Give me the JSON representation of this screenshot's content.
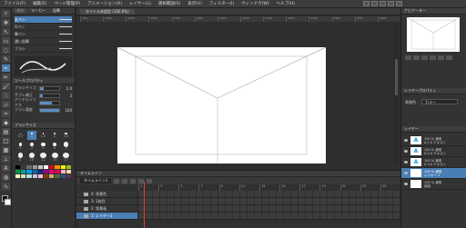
{
  "menu": [
    "ファイル(F)",
    "編集(E)",
    "ページ管理(P)",
    "アニメーション(A)",
    "レイヤー(L)",
    "選択範囲(S)",
    "表示(V)",
    "フィルター(I)",
    "ウィンドウ(W)",
    "ヘルプ(H)"
  ],
  "sub_tool": {
    "tabs": [
      "ペン",
      "マーカー",
      "鉛筆"
    ],
    "brushes": [
      {
        "label": "丸ペン"
      },
      {
        "label": "Gペン"
      },
      {
        "label": "筆ペン"
      },
      {
        "label": "濃い鉛筆"
      },
      {
        "label": "ブラシ"
      }
    ]
  },
  "tool_property": {
    "title": "ツールプロパティ",
    "rows": [
      {
        "label": "ブラシサイズ",
        "value": "1.0",
        "fill": 0.2
      },
      {
        "label": "手ブレ補正",
        "value": "3",
        "fill": 0.15
      },
      {
        "label": "アンチエイリアス",
        "value": "",
        "fill": 0.6
      },
      {
        "label": "ブラシ濃度",
        "value": "100",
        "fill": 1.0
      }
    ]
  },
  "brush_size": {
    "title": "ブラシサイズ",
    "sizes": [
      "0.7",
      "1",
      "1.5",
      "2",
      "2.5",
      "3",
      "4",
      "5",
      "6",
      "7",
      "8",
      "10",
      "12",
      "15",
      "17"
    ]
  },
  "palette_colors": [
    "#000000",
    "#3a3a3a",
    "#6e6e6e",
    "#9b9b9b",
    "#c8c8c8",
    "#ffffff",
    "#e60012",
    "#f39800",
    "#fff100",
    "#8fc31f",
    "#009944",
    "#009e96",
    "#00a0e9",
    "#0068b7",
    "#1d2088",
    "#920783",
    "#e4007f",
    "#e5004f",
    "#f4b4c3",
    "#ffd8a8",
    "#fffad0",
    "#c9e6b4",
    "#b4dde8",
    "#c7c3e6",
    "#f9c0d8",
    "#7f3f00",
    "#d4a373",
    "#4d6b3a",
    "#2c4f80",
    "#6b2c5a"
  ],
  "canvas_tab": "タイトル未設定 (100.0%)",
  "ruler_marks": [
    "750",
    "1000",
    "1250",
    "1500",
    "1750",
    "2000",
    "2250",
    "2500",
    "2750",
    "3000",
    "3250",
    "3500",
    "3750",
    "4000"
  ],
  "timeline": {
    "title": "タイムライン",
    "name": "タイムライン1",
    "frames": [
      "1",
      "3",
      "5",
      "7",
      "9",
      "11",
      "13",
      "15",
      "17",
      "19",
      "21",
      "23",
      "25"
    ],
    "rows": [
      {
        "label": "4: 背景色"
      },
      {
        "label": "3: 1枚目"
      },
      {
        "label": "2: 背景画"
      },
      {
        "label": "1: レイヤー1"
      }
    ]
  },
  "navigator": {
    "title": "ナビゲーター"
  },
  "layer_property": {
    "title": "レイヤープロパティ",
    "blend_label": "表現色",
    "blend_value": "カラー"
  },
  "layers": {
    "title": "レイヤー",
    "rows": [
      {
        "name": "100 % 通常",
        "sub": "A 1.0 テキスト",
        "thumb": "A"
      },
      {
        "name": "100 % 通常",
        "sub": "A 2.0 テキスト",
        "thumb": "A"
      },
      {
        "name": "100 % 通常",
        "sub": "A 3.0 テキスト",
        "thumb": "A"
      },
      {
        "name": "100 % 通常",
        "sub": "レイヤー 1",
        "thumb": ""
      },
      {
        "name": "100 % 通常",
        "sub": "用紙",
        "thumb": ""
      }
    ]
  }
}
